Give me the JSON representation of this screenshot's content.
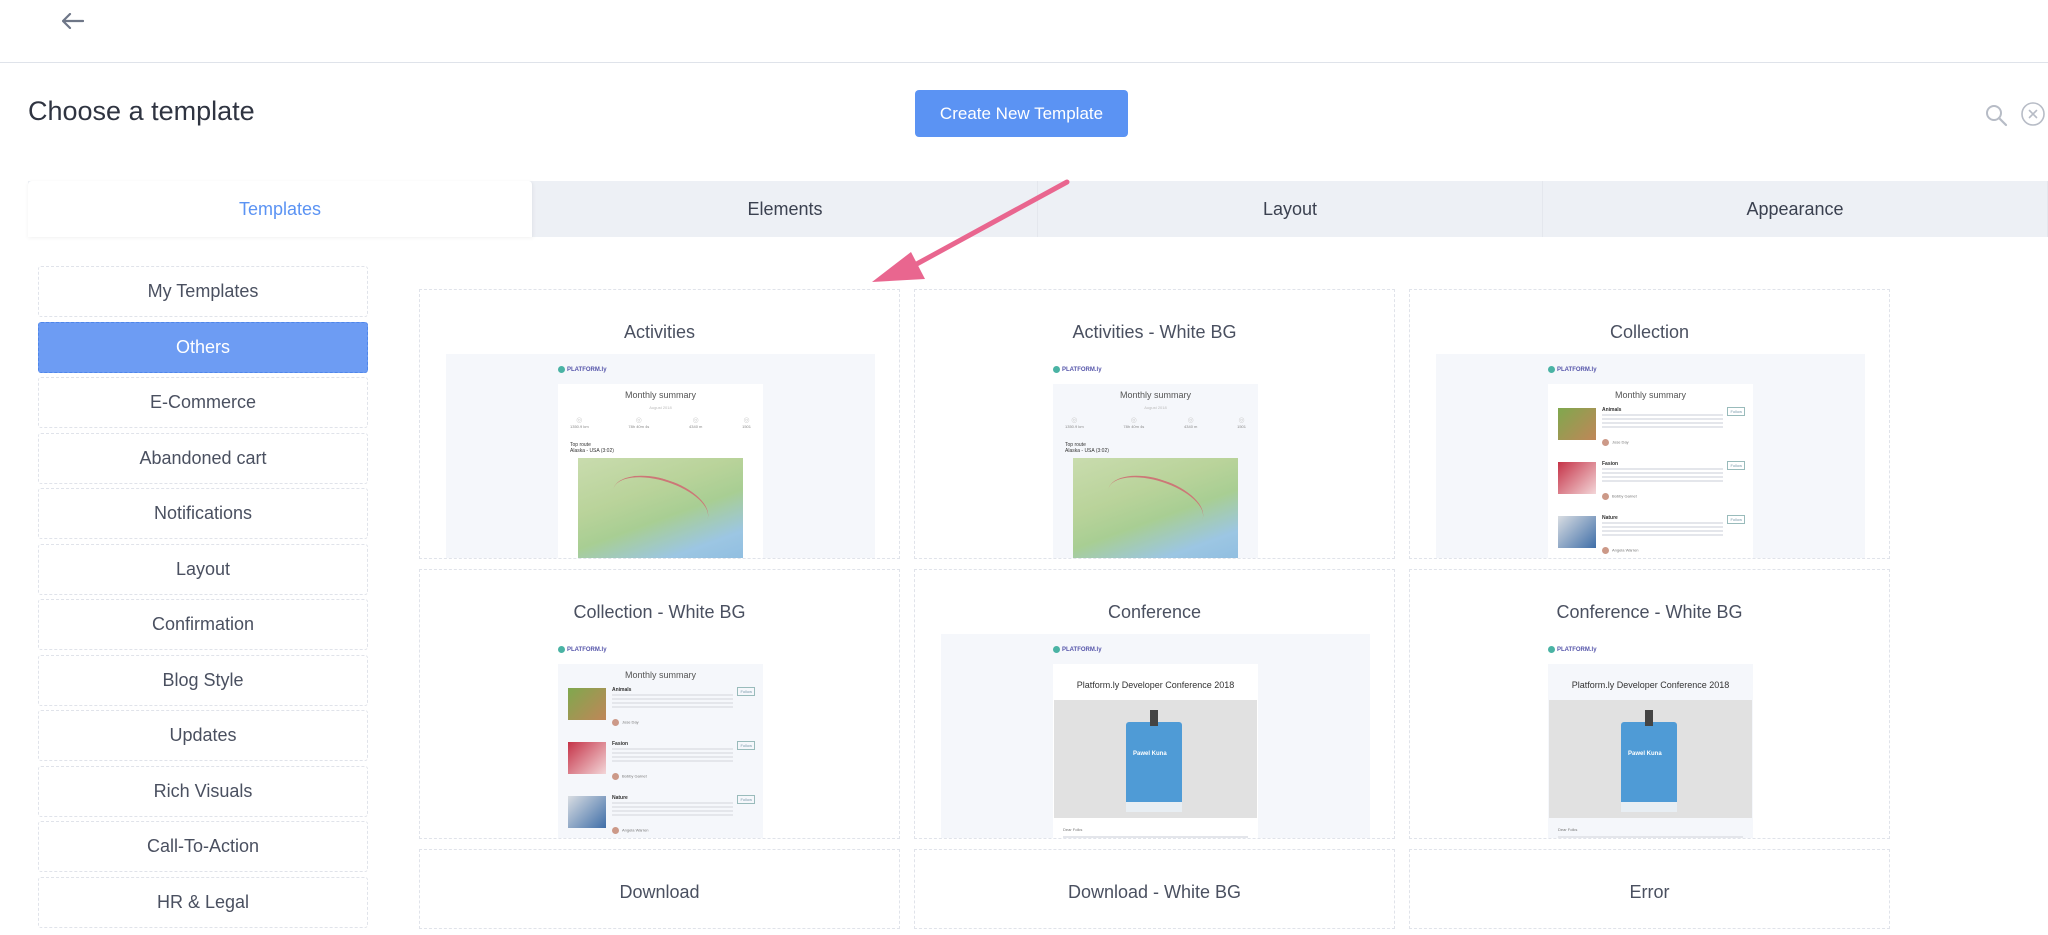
{
  "header": {
    "back_icon": "arrow-left-icon"
  },
  "page": {
    "title": "Choose a template",
    "create_button": "Create New Template",
    "search_icon": "search-icon",
    "close_icon": "close-circle-icon"
  },
  "tabs": [
    {
      "label": "Templates",
      "active": true
    },
    {
      "label": "Elements",
      "active": false
    },
    {
      "label": "Layout",
      "active": false
    },
    {
      "label": "Appearance",
      "active": false
    }
  ],
  "sidebar": {
    "items": [
      {
        "label": "My Templates",
        "active": false
      },
      {
        "label": "Others",
        "active": true
      },
      {
        "label": "E-Commerce",
        "active": false
      },
      {
        "label": "Abandoned cart",
        "active": false
      },
      {
        "label": "Notifications",
        "active": false
      },
      {
        "label": "Layout",
        "active": false
      },
      {
        "label": "Confirmation",
        "active": false
      },
      {
        "label": "Blog Style",
        "active": false
      },
      {
        "label": "Updates",
        "active": false
      },
      {
        "label": "Rich Visuals",
        "active": false
      },
      {
        "label": "Call-To-Action",
        "active": false
      },
      {
        "label": "HR & Legal",
        "active": false
      }
    ]
  },
  "preview": {
    "logo": "PLATFORM.ly",
    "monthly_summary": "Monthly summary",
    "month": "August 2018",
    "stats": [
      "1350.9 km",
      "78h 40m 4s",
      "4340 m",
      "1501"
    ],
    "top_route": "Top route",
    "route": "Alaska - USA (3:02)",
    "collection_rows": [
      {
        "name": "Animals",
        "author": "Jose Day",
        "follow": "Follow"
      },
      {
        "name": "Fasion",
        "author": "Bobby Garnet",
        "follow": "Follow"
      },
      {
        "name": "Nature",
        "author": "Angela Warren",
        "follow": "Follow"
      }
    ],
    "conference_title": "Platform.ly Developer Conference 2018",
    "badge_name": "Pawel Kuna",
    "dear_folks": "Dear Folks"
  },
  "templates": [
    {
      "title": "Activities",
      "kind": "activities",
      "white_bg": false
    },
    {
      "title": "Activities - White BG",
      "kind": "activities",
      "white_bg": true
    },
    {
      "title": "Collection",
      "kind": "collection",
      "white_bg": false
    },
    {
      "title": "Collection - White BG",
      "kind": "collection",
      "white_bg": true
    },
    {
      "title": "Conference",
      "kind": "conference",
      "white_bg": false
    },
    {
      "title": "Conference - White BG",
      "kind": "conference",
      "white_bg": true
    },
    {
      "title": "Download",
      "kind": "none",
      "white_bg": false
    },
    {
      "title": "Download - White BG",
      "kind": "none",
      "white_bg": true
    },
    {
      "title": "Error",
      "kind": "none",
      "white_bg": false
    }
  ],
  "colors": {
    "accent": "#5b93f3",
    "sidebar_active": "#6d9cf3",
    "annotation_arrow": "#e9668f"
  }
}
